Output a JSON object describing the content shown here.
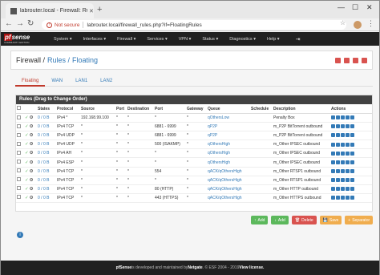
{
  "browser": {
    "tab_title": "labrouter.local - Firewall: Rules: F",
    "not_secure": "Not secure",
    "url": "labrouter.local/firewall_rules.php?if=FloatingRules"
  },
  "nav": {
    "logo": "sense",
    "logo_prefix": "pf",
    "logo_sub": "COMMUNITY EDITION",
    "items": [
      "System ▾",
      "Interfaces ▾",
      "Firewall ▾",
      "Services ▾",
      "VPN ▾",
      "Status ▾",
      "Diagnostics ▾",
      "Help ▾"
    ]
  },
  "breadcrumb": {
    "part1": "Firewall /",
    "part2": "Rules /",
    "part3": "Floating"
  },
  "tabs": [
    "Floating",
    "WAN",
    "LAN1",
    "LAN2"
  ],
  "panel": {
    "title": "Rules (Drag to Change Order)",
    "headers": [
      "",
      "",
      "States",
      "Protocol",
      "Source",
      "Port",
      "Destination",
      "Port",
      "Gateway",
      "Queue",
      "Schedule",
      "Description",
      "Actions"
    ],
    "rows": [
      {
        "states": "0 / 0 B",
        "protocol": "IPv4 *",
        "source": "192.168.99.100",
        "sport": "*",
        "dest": "*",
        "dport": "*",
        "gateway": "*",
        "queue": "qOthersLow",
        "schedule": "",
        "desc": "Penalty Box"
      },
      {
        "states": "0 / 0 B",
        "protocol": "IPv4 TCP",
        "source": "*",
        "sport": "*",
        "dest": "*",
        "dport": "6881 - 6999",
        "gateway": "*",
        "queue": "qP2P",
        "schedule": "",
        "desc": "m_P2P BitTorrent outbound"
      },
      {
        "states": "0 / 0 B",
        "protocol": "IPv4 UDP",
        "source": "*",
        "sport": "*",
        "dest": "*",
        "dport": "6881 - 6999",
        "gateway": "*",
        "queue": "qP2P",
        "schedule": "",
        "desc": "m_P2P BitTorrent outbound"
      },
      {
        "states": "0 / 0 B",
        "protocol": "IPv4 UDP",
        "source": "*",
        "sport": "*",
        "dest": "*",
        "dport": "500 (ISAKMP)",
        "gateway": "*",
        "queue": "qOthersHigh",
        "schedule": "",
        "desc": "m_Other IPSEC outbound"
      },
      {
        "states": "0 / 0 B",
        "protocol": "IPv4 AH",
        "source": "*",
        "sport": "*",
        "dest": "*",
        "dport": "*",
        "gateway": "*",
        "queue": "qOthersHigh",
        "schedule": "",
        "desc": "m_Other IPSEC outbound"
      },
      {
        "states": "0 / 0 B",
        "protocol": "IPv4 ESP",
        "source": "*",
        "sport": "*",
        "dest": "*",
        "dport": "*",
        "gateway": "*",
        "queue": "qOthersHigh",
        "schedule": "",
        "desc": "m_Other IPSEC outbound"
      },
      {
        "states": "0 / 0 B",
        "protocol": "IPv4 TCP",
        "source": "*",
        "sport": "*",
        "dest": "*",
        "dport": "554",
        "gateway": "*",
        "queue": "qACK/qOthersHigh",
        "schedule": "",
        "desc": "m_Other RTSP1 outbound"
      },
      {
        "states": "0 / 0 B",
        "protocol": "IPv4 TCP",
        "source": "*",
        "sport": "*",
        "dest": "*",
        "dport": "*",
        "gateway": "*",
        "queue": "qACK/qOthersHigh",
        "schedule": "",
        "desc": "m_Other RTSP1 outbound"
      },
      {
        "states": "0 / 0 B",
        "protocol": "IPv4 TCP",
        "source": "*",
        "sport": "*",
        "dest": "*",
        "dport": "80 (HTTP)",
        "gateway": "*",
        "queue": "qACK/qOthersHigh",
        "schedule": "",
        "desc": "m_Other HTTP outbound"
      },
      {
        "states": "0 / 0 B",
        "protocol": "IPv4 TCP",
        "source": "*",
        "sport": "*",
        "dest": "*",
        "dport": "443 (HTTPS)",
        "gateway": "*",
        "queue": "qACK/qOthersHigh",
        "schedule": "",
        "desc": "m_Other HTTPS outbound"
      }
    ]
  },
  "buttons": [
    {
      "label": "Add",
      "color": "#5cb85c",
      "icon": "↑"
    },
    {
      "label": "Add",
      "color": "#5cb85c",
      "icon": "↓"
    },
    {
      "label": "Delete",
      "color": "#d9534f",
      "icon": "🗑"
    },
    {
      "label": "Save",
      "color": "#f0ad4e",
      "icon": "💾"
    },
    {
      "label": "Separator",
      "color": "#f0ad4e",
      "icon": "+"
    }
  ],
  "footer": {
    "brand": "pfSense",
    "text": " is developed and maintained by ",
    "company": "Netgate",
    "copy": ". © ESF 2004 - 2019 ",
    "link": "View license."
  }
}
